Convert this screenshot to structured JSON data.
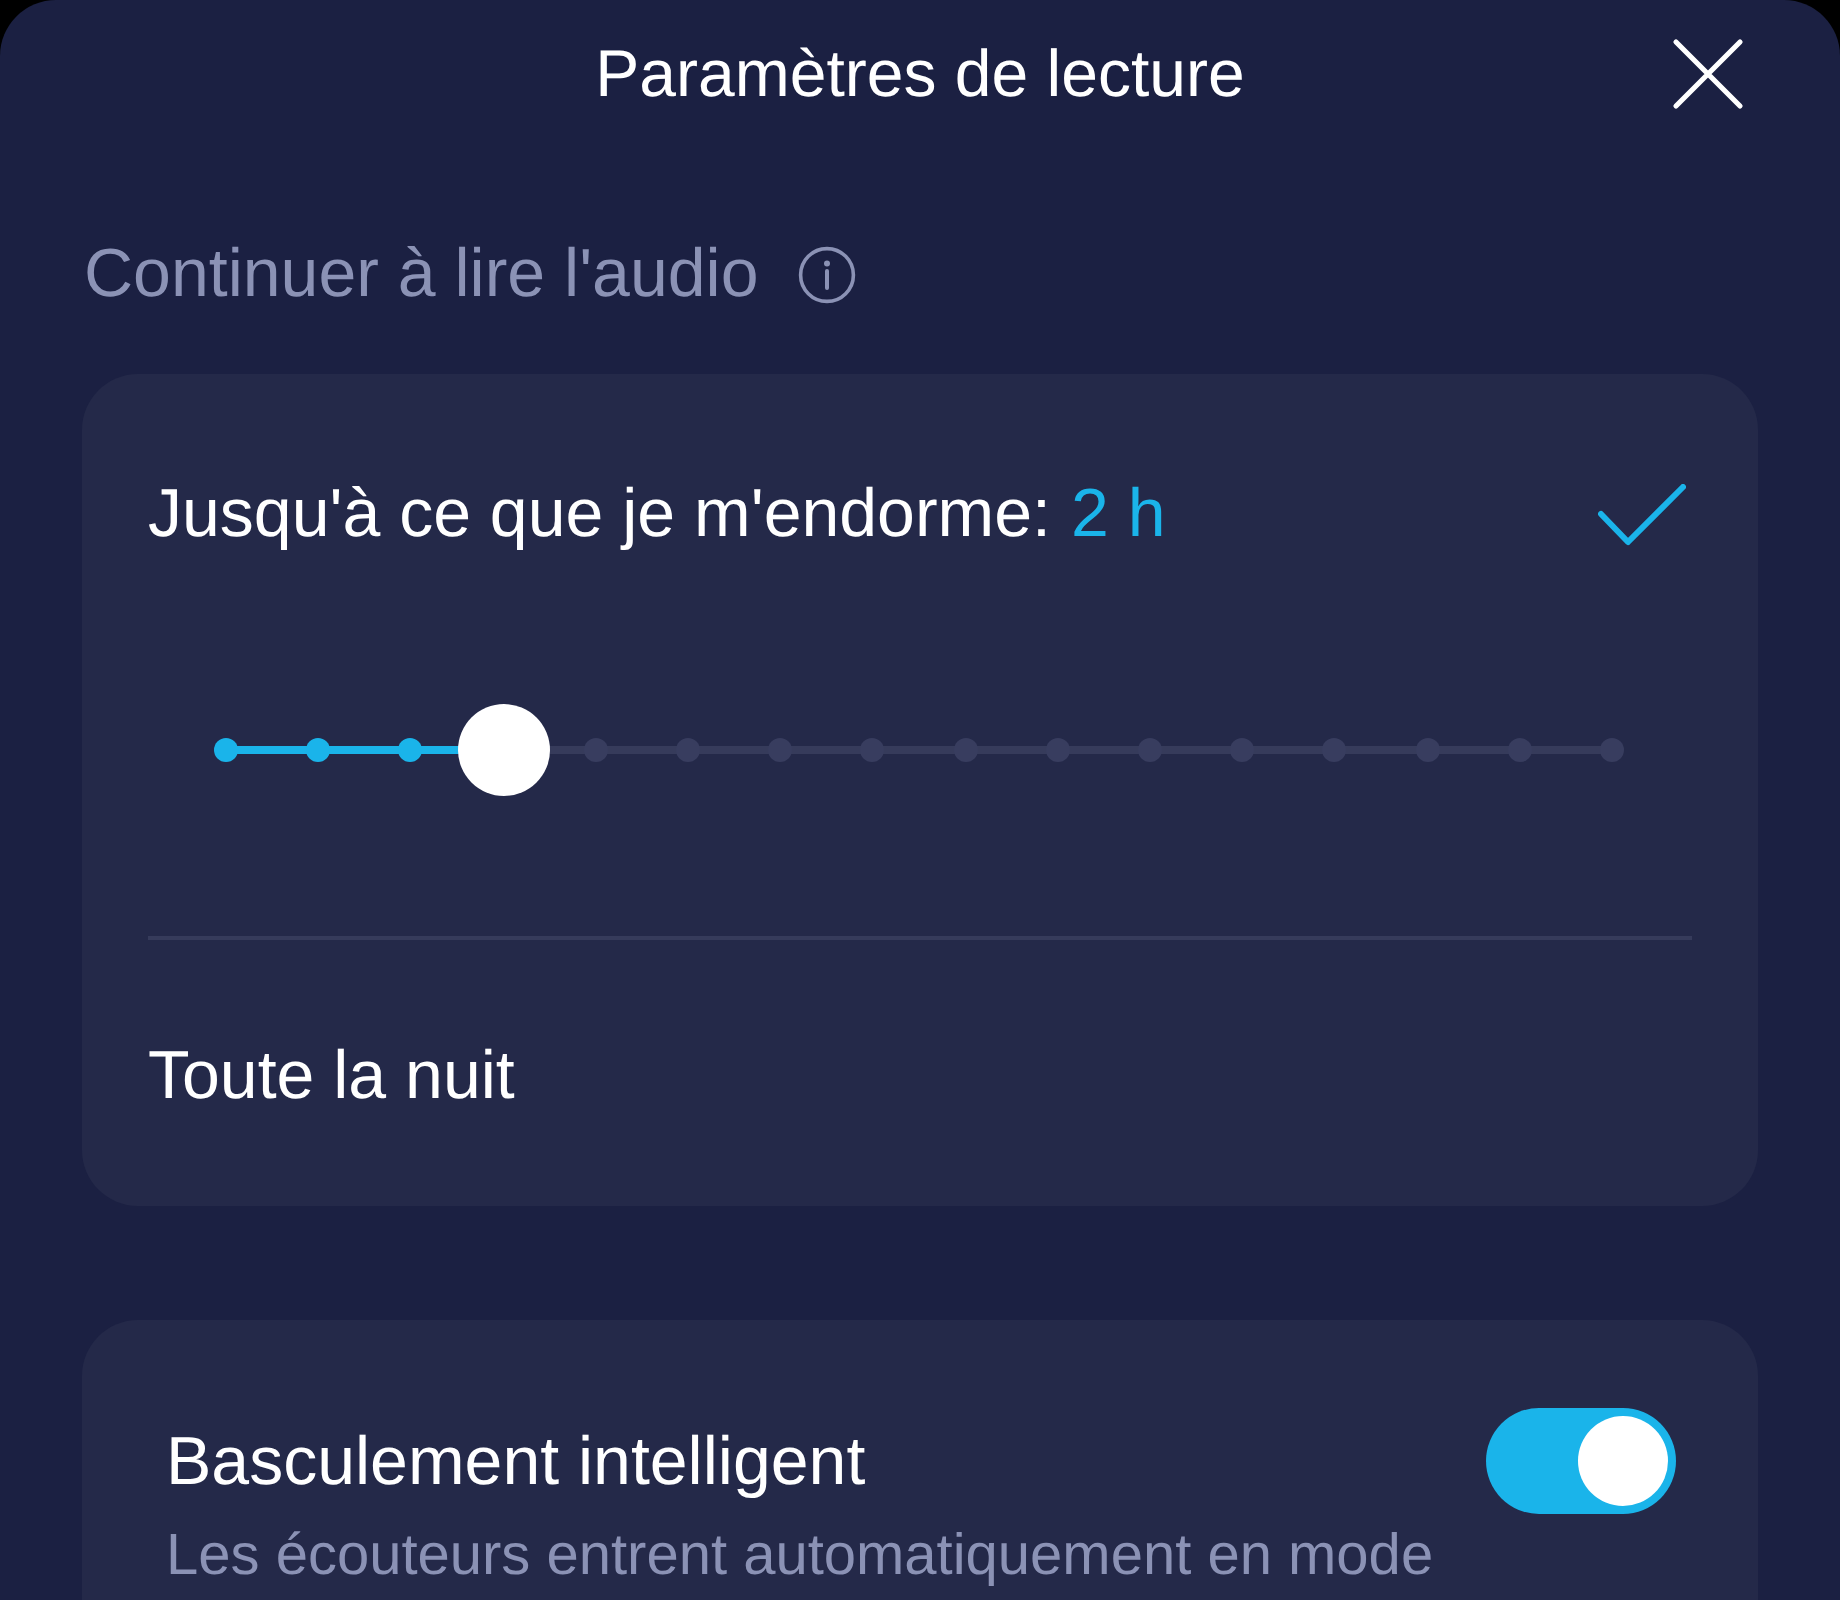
{
  "header": {
    "title": "Paramètres de lecture"
  },
  "section": {
    "label": "Continuer à lire l'audio"
  },
  "sleep_card": {
    "options": [
      {
        "kind": "slider",
        "label": "Jusqu'à ce que je m'endorme:",
        "value": "2 h",
        "selected": true,
        "slider": {
          "level": 0.2
        }
      },
      {
        "kind": "plain",
        "label": "Toute la nuit",
        "selected": false
      }
    ]
  },
  "smart_switch_card": {
    "title": "Basculement intelligent",
    "on": true,
    "description": "Les écouteurs entrent automatiquement en mode"
  }
}
